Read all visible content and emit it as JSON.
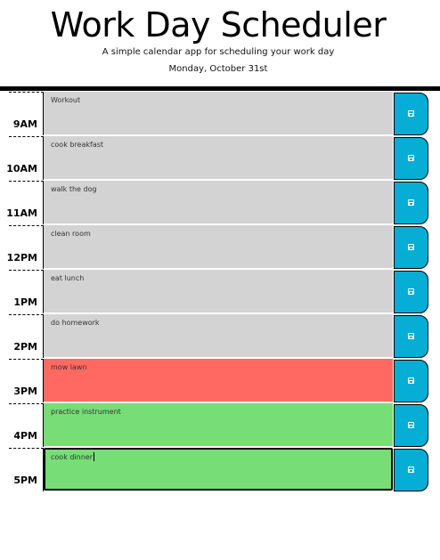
{
  "header": {
    "title": "Work Day Scheduler",
    "lead": "A simple calendar app for scheduling your work day",
    "current_day": "Monday, October 31st"
  },
  "colors": {
    "past": "#d3d3d3",
    "present": "#ff6961",
    "future": "#77dd77",
    "save_button": "#06aed5"
  },
  "rows": [
    {
      "hour": "9AM",
      "text": "Workout",
      "state": "past"
    },
    {
      "hour": "10AM",
      "text": "cook breakfast",
      "state": "past"
    },
    {
      "hour": "11AM",
      "text": "walk the dog",
      "state": "past"
    },
    {
      "hour": "12PM",
      "text": "clean room",
      "state": "past"
    },
    {
      "hour": "1PM",
      "text": "eat lunch",
      "state": "past"
    },
    {
      "hour": "2PM",
      "text": "do homework",
      "state": "past"
    },
    {
      "hour": "3PM",
      "text": "mow lawn",
      "state": "present"
    },
    {
      "hour": "4PM",
      "text": "practice instrument",
      "state": "future"
    },
    {
      "hour": "5PM",
      "text": "cook dinner",
      "state": "future"
    }
  ],
  "save_icon": "save-icon"
}
